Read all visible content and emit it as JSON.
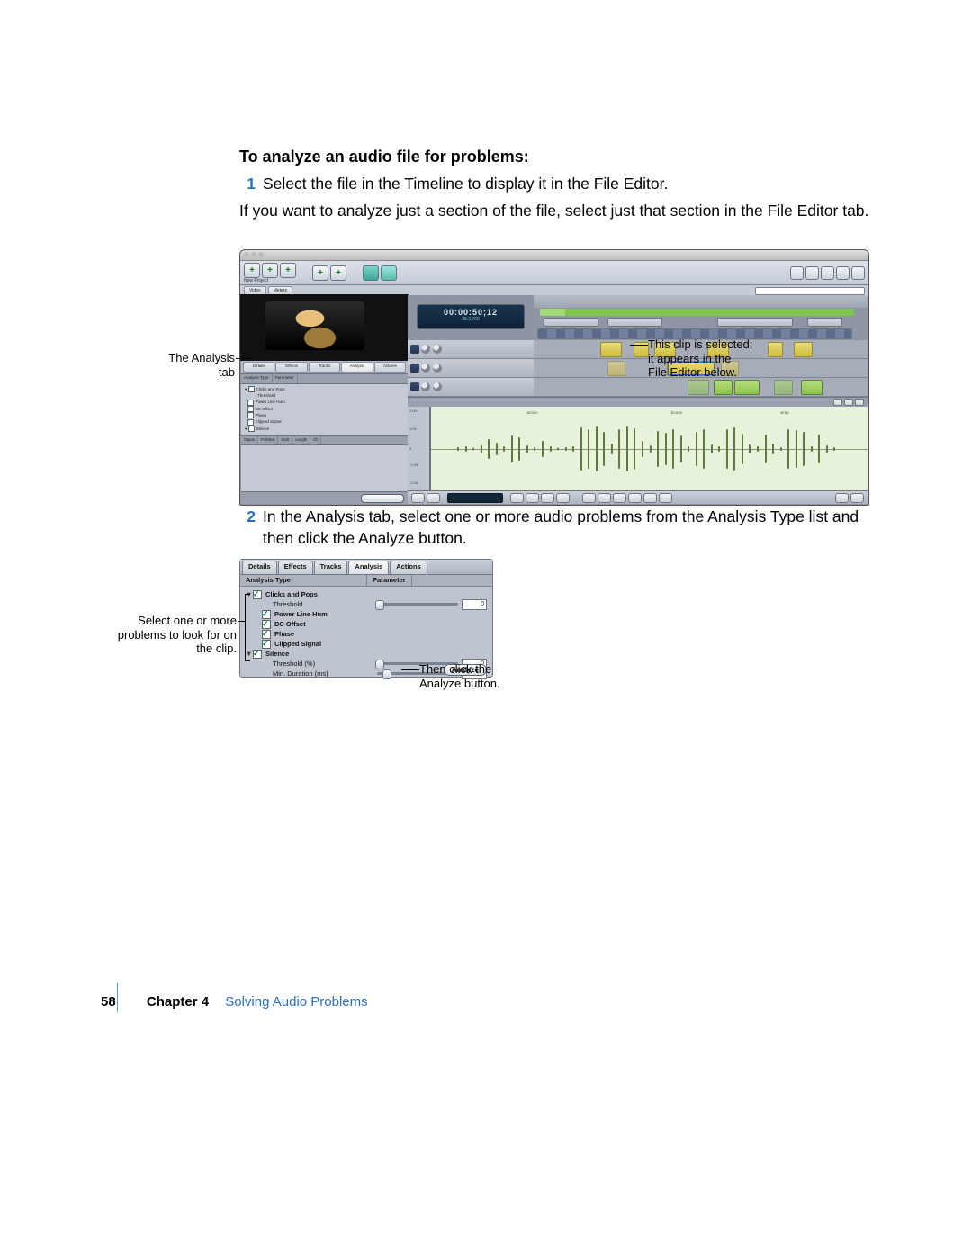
{
  "heading": "To analyze an audio file for problems:",
  "step1_num": "1",
  "step1_text": "Select the file in the Timeline to display it in the File Editor.",
  "step1_note": "If you want to analyze just a section of the file, select just that section in the File Editor tab.",
  "step2_num": "2",
  "step2_text": "In the Analysis tab, select one or more audio problems from the Analysis Type list and then click the Analyze button.",
  "callouts": {
    "analysis_tab": "The Analysis tab",
    "clip_selected_l1": "This clip is selected;",
    "clip_selected_l2": "it appears in the",
    "clip_selected_l3": "File Editor below.",
    "select_l1": "Select one or more",
    "select_l2": "problems to look for on",
    "select_l3": "the clip.",
    "analyze_l1": "Then click the",
    "analyze_l2": "Analyze button."
  },
  "app": {
    "title": "",
    "toolbar_groups": [
      [
        "New Project",
        "New Audio File",
        "New Track"
      ],
      [
        "Add Time Marker",
        "Time Window"
      ],
      [
        "",
        ""
      ]
    ],
    "subbar_tabs": [
      "Video",
      "Meters"
    ],
    "timecode_big": "00:00:50;12",
    "timecode_small": "38.3.760",
    "left_tabs": [
      "Details",
      "Effects",
      "Tracks",
      "Analysis",
      "Actions"
    ],
    "left_tabs_active": "Analysis",
    "analysis_hdr": [
      "Analysis Type",
      "Parameter"
    ],
    "analysis_items": [
      {
        "label": "Clicks and Pops",
        "checked": true,
        "group": true
      },
      {
        "label": "Threshold",
        "child": true
      },
      {
        "label": "Power Line Hum",
        "checked": true
      },
      {
        "label": "DC Offset",
        "checked": true
      },
      {
        "label": "Phase",
        "checked": true
      },
      {
        "label": "Clipped Signal",
        "checked": true
      },
      {
        "label": "Silence",
        "checked": true,
        "group": true
      }
    ],
    "results_hdr": [
      "Status",
      "Problem",
      "Start",
      "Length",
      "Ch"
    ],
    "analyze_btn": "Analyze",
    "fe_ticks": [
      "2.00",
      "1.00",
      "0",
      "-1.00",
      "-2.00"
    ],
    "fe_markers": [
      "action",
      "bonus",
      "wrap"
    ]
  },
  "panel2": {
    "tabs": [
      "Details",
      "Effects",
      "Tracks",
      "Analysis",
      "Actions"
    ],
    "tabs_active": "Analysis",
    "col1": "Analysis Type",
    "col2": "Parameter",
    "rows": {
      "cp": "Clicks and Pops",
      "cp_thr": "Threshold",
      "hum": "Power Line Hum",
      "dc": "DC Offset",
      "phase": "Phase",
      "clip": "Clipped Signal",
      "sil": "Silence",
      "sil_thr": "Threshold (%)",
      "sil_dur": "Min. Duration (ms)"
    },
    "vals": {
      "cp_thr": "0",
      "sil_thr": "0",
      "sil_dur": "100"
    },
    "analyze": "Analyze"
  },
  "footer": {
    "page": "58",
    "chapter": "Chapter 4",
    "title": "Solving Audio Problems"
  }
}
